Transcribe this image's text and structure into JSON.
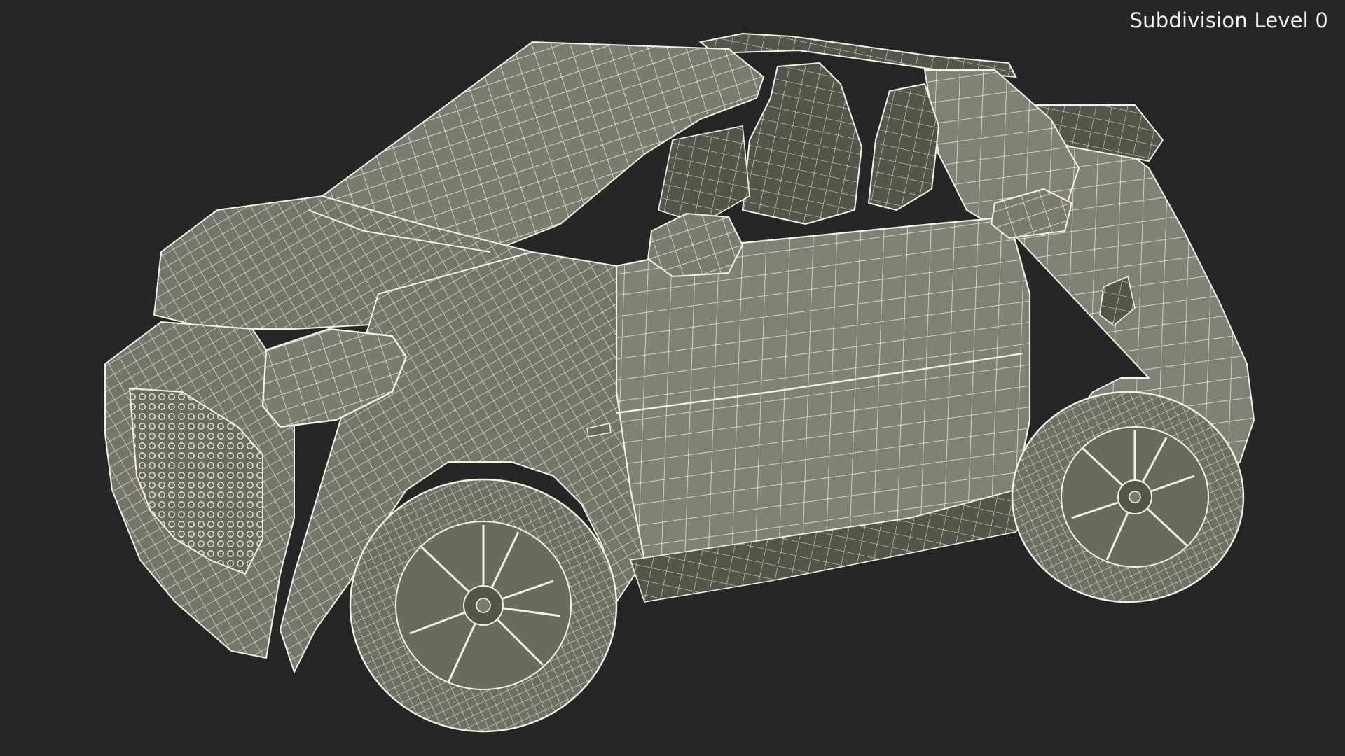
{
  "viewport": {
    "overlay_label": "Subdivision Level 0"
  },
  "colors": {
    "background": "#262626",
    "mesh_fill": "#7a7a6e",
    "mesh_fill_dark": "#5d5d55",
    "mesh_fill_light": "#8c8c80",
    "wire": "#f3f1e3",
    "label_text": "#f2f2f2"
  },
  "model": {
    "subject": "convertible-city-car-wireframe",
    "icon": "car-wireframe-model"
  }
}
